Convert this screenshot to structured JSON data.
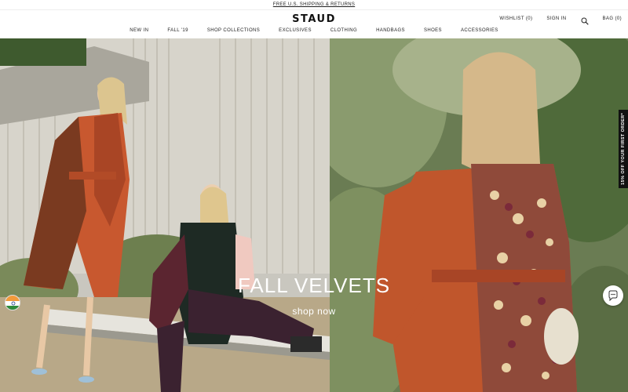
{
  "promo": {
    "text": "FREE U.S. SHIPPING & RETURNS"
  },
  "brand": {
    "logo": "STAUD"
  },
  "utility": {
    "wishlist": "WISHLIST (0)",
    "sign_in": "SIGN IN",
    "search_icon": "search-icon",
    "bag": "BAG (0)"
  },
  "nav": {
    "items": [
      "NEW IN",
      "FALL '19",
      "SHOP COLLECTIONS",
      "EXCLUSIVES",
      "CLOTHING",
      "HANDBAGS",
      "SHOES",
      "ACCESSORIES"
    ]
  },
  "hero": {
    "title": "FALL VELVETS",
    "cta": "shop now"
  },
  "side_tab": {
    "text": "15% OFF YOUR FIRST ORDER*"
  },
  "widgets": {
    "flag_icon": "india-flag-icon",
    "chat_icon": "chat-icon"
  },
  "colors": {
    "accent": "#111111",
    "velvet_rust": "#c4582e",
    "foliage": "#5f7346"
  }
}
